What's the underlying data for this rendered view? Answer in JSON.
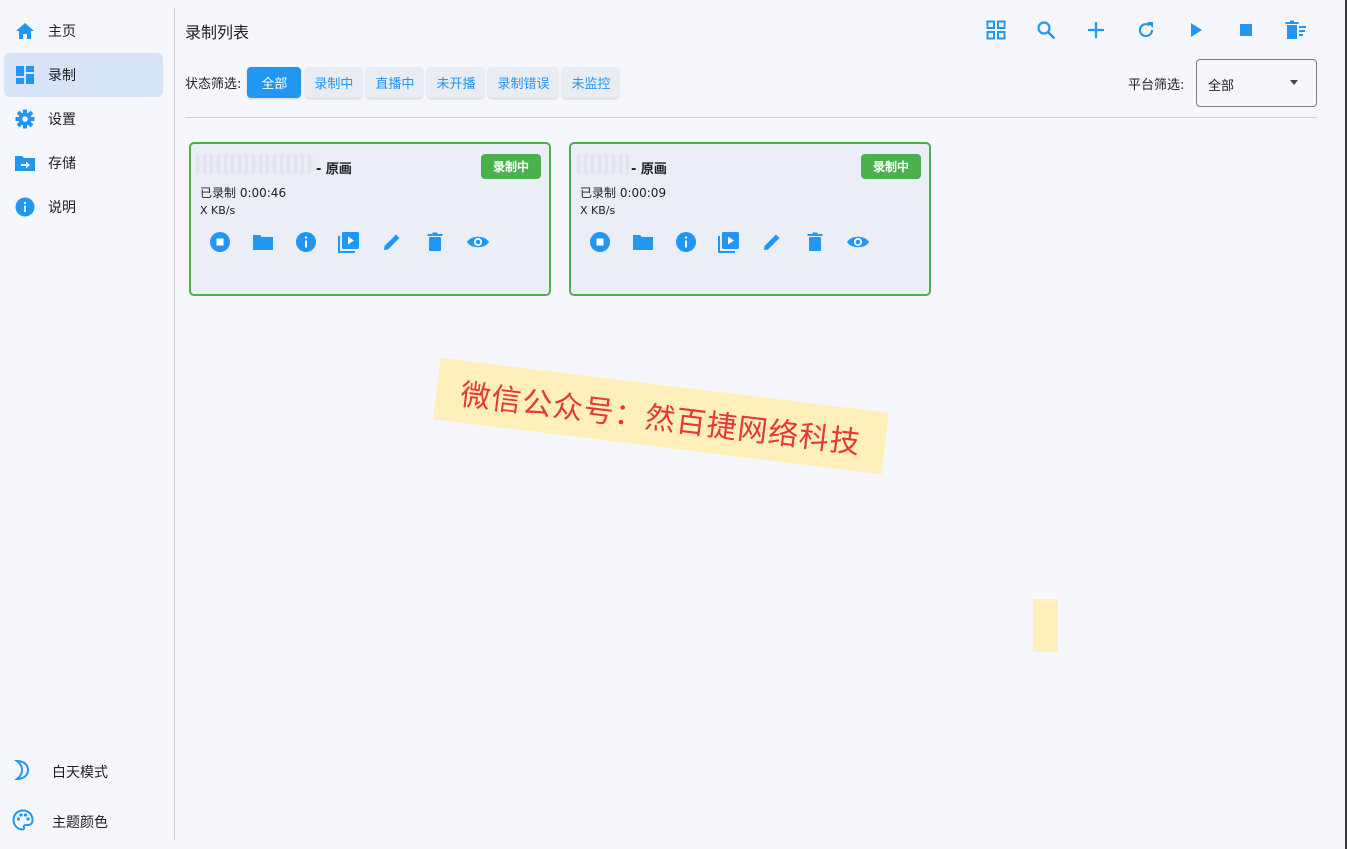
{
  "sidebar": {
    "items": [
      {
        "label": "主页",
        "icon": "home-icon"
      },
      {
        "label": "录制",
        "icon": "dashboard-icon"
      },
      {
        "label": "设置",
        "icon": "gear-icon"
      },
      {
        "label": "存储",
        "icon": "folder-arrow-icon"
      },
      {
        "label": "说明",
        "icon": "info-icon"
      }
    ],
    "active": 1,
    "day_mode_label": "白天模式",
    "theme_color_label": "主题颜色"
  },
  "header": {
    "title": "录制列表",
    "toolbar": [
      "grid-icon",
      "search-icon",
      "plus-icon",
      "refresh-icon",
      "play-icon",
      "stop-icon",
      "delete-list-icon"
    ]
  },
  "filters": {
    "status_label": "状态筛选:",
    "status_options": [
      "全部",
      "录制中",
      "直播中",
      "未开播",
      "录制错误",
      "未监控"
    ],
    "status_active": 0,
    "platform_label": "平台筛选:",
    "platform_value": "全部"
  },
  "cards": [
    {
      "quality": "- 原画",
      "badge": "录制中",
      "duration": "已录制 0:00:46",
      "speed": "X KB/s"
    },
    {
      "quality": "- 原画",
      "badge": "录制中",
      "duration": "已录制 0:00:09",
      "speed": "X KB/s"
    }
  ],
  "watermark": "微信公众号：然百捷网络科技",
  "colors": {
    "accent": "#2196f3",
    "recording": "#4caf50",
    "watermark_text": "#e53935",
    "watermark_bg": "#fff0bb"
  }
}
